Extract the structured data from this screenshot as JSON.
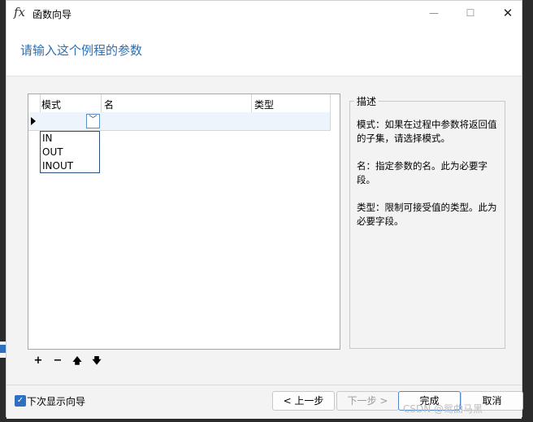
{
  "window": {
    "title": "函数向导",
    "app_icon_glyph": "fx"
  },
  "header": {
    "heading": "请输入这个例程的参数"
  },
  "grid": {
    "columns": [
      "模式",
      "名",
      "类型"
    ],
    "dropdown_options": [
      "IN",
      "OUT",
      "INOUT"
    ]
  },
  "description": {
    "legend": "描述",
    "text": "模式：如果在过程中参数将返回值的子集，请选择模式。\n\n名：指定参数的名。此为必要字段。\n\n类型：限制可接受值的类型。此为必要字段。"
  },
  "toolbar": {
    "add": "+",
    "remove": "−",
    "up": "🡅",
    "down": "🡇"
  },
  "footer": {
    "show_next_time_label": "下次显示向导",
    "prev_label": "< 上一步",
    "next_label": "下一步 >",
    "finish_label": "完成",
    "cancel_label": "取消"
  },
  "watermark": "CSDN @鸳曲马黑",
  "colors": {
    "accent": "#2a6fb4",
    "checkbox": "#2f6fbf"
  }
}
